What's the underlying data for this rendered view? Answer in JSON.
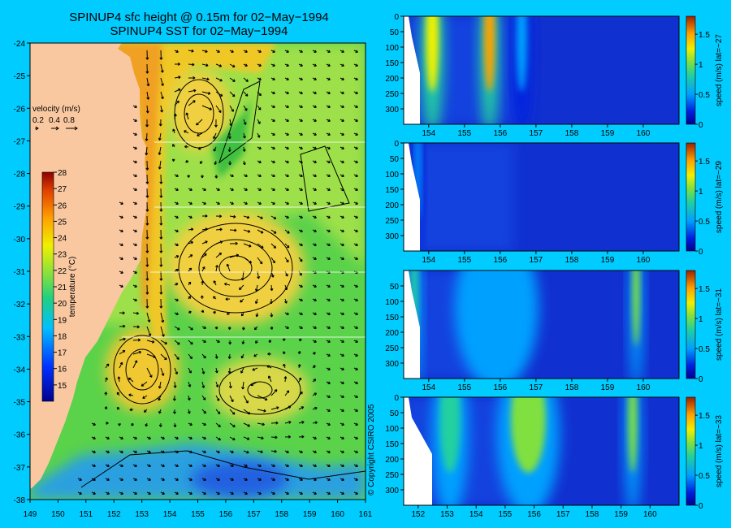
{
  "titles": {
    "line1": "SPINUP4 sfc height @ 0.15m for 02−May−1994",
    "line2": "SPINUP4 SST for 02−May−1994"
  },
  "copyright": "© Copyright CSIRO 2005",
  "colors": {
    "background": "#00ccff",
    "land": "#f9c8a0"
  },
  "chart_data": [
    {
      "type": "heatmap",
      "title": "SPINUP4 SST for 02−May−1994",
      "x_ticks": [
        "149",
        "150",
        "151",
        "152",
        "153",
        "154",
        "155",
        "156",
        "157",
        "158",
        "159",
        "160",
        "161"
      ],
      "y_ticks": [
        "-24",
        "-25",
        "-26",
        "-27",
        "-28",
        "-29",
        "-30",
        "-31",
        "-32",
        "-33",
        "-34",
        "-35",
        "-36",
        "-37",
        "-38"
      ],
      "xlim": [
        149,
        161
      ],
      "ylim": [
        -38,
        -24
      ],
      "colorbar": {
        "label": "temperature (°C)",
        "ticks": [
          "28",
          "27",
          "26",
          "25",
          "24",
          "23",
          "22",
          "21",
          "20",
          "19",
          "18",
          "17",
          "16",
          "15"
        ],
        "range": [
          14,
          28
        ]
      },
      "vector_legend": {
        "title": "velocity (m/s)",
        "values": [
          "0.2",
          "0.4",
          "0.8"
        ]
      },
      "eddies": [
        {
          "x": 155,
          "y": -26,
          "rx": 1,
          "ry": 1.2,
          "temp": 24.5
        },
        {
          "x": 156.4,
          "y": -31,
          "rx": 1.8,
          "ry": 1.6,
          "temp": 24
        },
        {
          "x": 153.3,
          "y": -34,
          "rx": 1.2,
          "ry": 1.3,
          "temp": 24
        },
        {
          "x": 156.1,
          "y": -34.7,
          "rx": 1.8,
          "ry": 1,
          "temp": 23.5
        }
      ]
    },
    {
      "type": "heatmap",
      "colorbar_label": "speed (m/s) lat=−27",
      "x_ticks": [
        "154",
        "155",
        "156",
        "157",
        "158",
        "159",
        "160"
      ],
      "xlim": [
        153.3,
        161
      ],
      "y_ticks": [
        "0",
        "50",
        "100",
        "150",
        "200",
        "250",
        "300"
      ],
      "ylim": [
        350,
        0
      ],
      "colorbar_ticks": [
        "1.5",
        "1",
        "0.5",
        "0"
      ],
      "jets": [
        {
          "x": 154.1,
          "w": 0.35,
          "speed": 1.4
        },
        {
          "x": 155.7,
          "w": 0.3,
          "speed": 1.5
        },
        {
          "x": 156.6,
          "w": 0.3,
          "speed": 0.6
        }
      ]
    },
    {
      "type": "heatmap",
      "colorbar_label": "speed (m/s) lat=−29",
      "x_ticks": [
        "154",
        "155",
        "156",
        "157",
        "158",
        "159",
        "160"
      ],
      "xlim": [
        153.3,
        161
      ],
      "y_ticks": [
        "0",
        "50",
        "100",
        "150",
        "200",
        "250",
        "300"
      ],
      "ylim": [
        350,
        0
      ],
      "colorbar_ticks": [
        "1.5",
        "1",
        "0.5",
        "0"
      ],
      "jets": [
        {
          "x": 153.7,
          "w": 0.15,
          "speed": 0.6
        }
      ]
    },
    {
      "type": "heatmap",
      "colorbar_label": "speed (m/s) lat=−31",
      "x_ticks": [
        "154",
        "155",
        "156",
        "157",
        "158",
        "159",
        "160"
      ],
      "xlim": [
        153.3,
        161
      ],
      "y_ticks": [
        "50",
        "100",
        "150",
        "200",
        "250",
        "300"
      ],
      "ylim": [
        350,
        0
      ],
      "colorbar_ticks": [
        "1.5",
        "1",
        "0.5",
        "0"
      ],
      "jets": [
        {
          "x": 153.6,
          "w": 0.2,
          "speed": 0.9
        },
        {
          "x": 155.9,
          "w": 1.3,
          "speed": 0.7
        },
        {
          "x": 159.8,
          "w": 0.2,
          "speed": 1.1
        }
      ]
    },
    {
      "type": "heatmap",
      "colorbar_label": "speed (m/s) lat=−33",
      "x_ticks": [
        "152",
        "153",
        "154",
        "155",
        "156",
        "157",
        "158",
        "159",
        "160"
      ],
      "xlim": [
        151.5,
        161
      ],
      "y_ticks": [
        "0",
        "50",
        "100",
        "150",
        "200",
        "250",
        "300"
      ],
      "ylim": [
        350,
        0
      ],
      "colorbar_ticks": [
        "1.5",
        "1",
        "0.5",
        "0"
      ],
      "jets": [
        {
          "x": 153.1,
          "w": 0.7,
          "speed": 0.8
        },
        {
          "x": 155.8,
          "w": 1.2,
          "speed": 1.0
        },
        {
          "x": 159.4,
          "w": 0.3,
          "speed": 1.0
        }
      ]
    }
  ]
}
